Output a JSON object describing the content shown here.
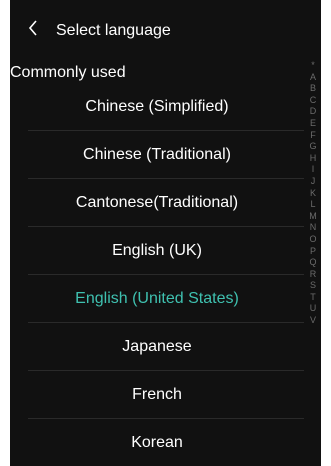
{
  "header": {
    "back_icon": "chevron-left-icon",
    "title": "Select language"
  },
  "section": {
    "label": "Commonly used"
  },
  "languages": [
    {
      "label": "Chinese (Simplified)",
      "selected": false
    },
    {
      "label": "Chinese (Traditional)",
      "selected": false
    },
    {
      "label": "Cantonese(Traditional)",
      "selected": false
    },
    {
      "label": "English (UK)",
      "selected": false
    },
    {
      "label": "English (United States)",
      "selected": true
    },
    {
      "label": "Japanese",
      "selected": false
    },
    {
      "label": "French",
      "selected": false
    },
    {
      "label": "Korean",
      "selected": false
    }
  ],
  "index_letters": [
    "*",
    "A",
    "B",
    "C",
    "D",
    "E",
    "F",
    "G",
    "H",
    "I",
    "J",
    "K",
    "L",
    "M",
    "N",
    "O",
    "P",
    "Q",
    "R",
    "S",
    "T",
    "U",
    "V"
  ],
  "colors": {
    "background": "#111111",
    "text": "#ffffff",
    "accent": "#3fc1b0",
    "index_text": "#6b6b6b"
  }
}
